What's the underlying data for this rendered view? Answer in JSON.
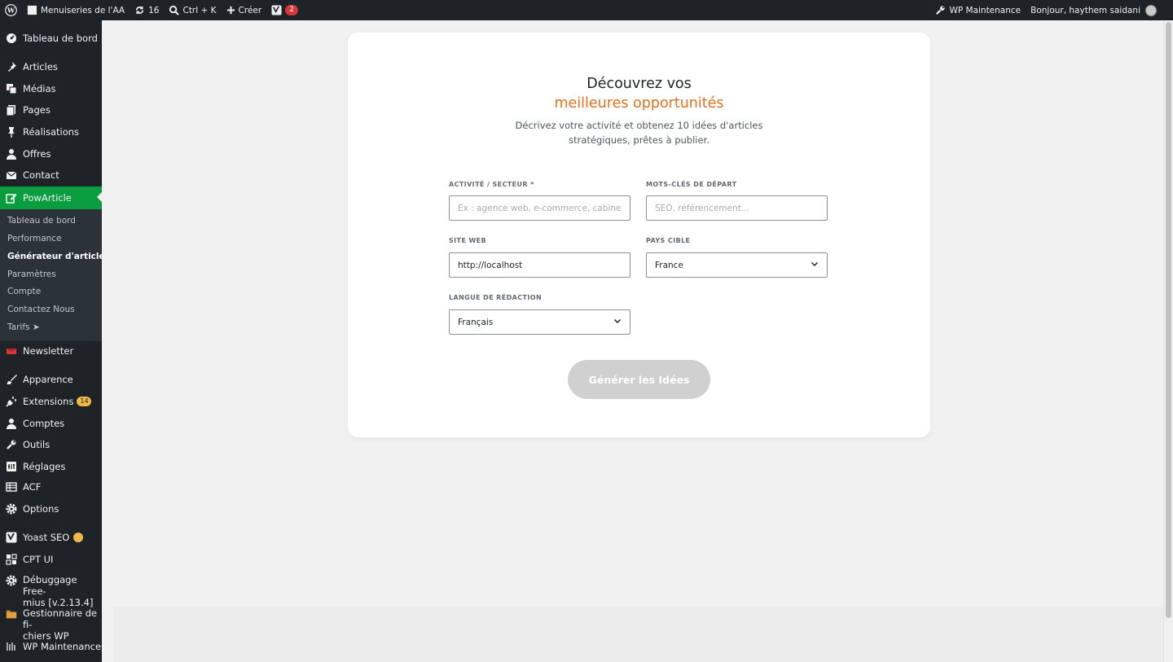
{
  "adminbar": {
    "site_name": "Menuiseries de l'AA",
    "updates_count": "16",
    "search_shortcut": "Ctrl + K",
    "new_label": "Créer",
    "yoast_count": "2",
    "wp_maintenance_label": "WP Maintenance",
    "greeting": "Bonjour, haythem saidani"
  },
  "sidebar": {
    "items": [
      {
        "label": "Tableau de bord",
        "icon": "dashboard-icon"
      },
      {
        "label": "Articles",
        "icon": "pin-icon"
      },
      {
        "label": "Médias",
        "icon": "media-icon"
      },
      {
        "label": "Pages",
        "icon": "pages-icon"
      },
      {
        "label": "Réalisations",
        "icon": "pushpin-icon"
      },
      {
        "label": "Offres",
        "icon": "person-icon"
      },
      {
        "label": "Contact",
        "icon": "envelope-icon"
      },
      {
        "label": "PowArticle",
        "icon": "edit-icon"
      },
      {
        "label": "Newsletter",
        "icon": "mail-icon"
      },
      {
        "label": "Apparence",
        "icon": "brush-icon"
      },
      {
        "label": "Extensions",
        "icon": "plug-icon",
        "badge": "14"
      },
      {
        "label": "Comptes",
        "icon": "user-icon"
      },
      {
        "label": "Outils",
        "icon": "wrench-icon"
      },
      {
        "label": "Réglages",
        "icon": "settings-icon"
      },
      {
        "label": "ACF",
        "icon": "grid-icon"
      },
      {
        "label": "Options",
        "icon": "gear-icon"
      },
      {
        "label": "Yoast SEO",
        "icon": "yoast-icon"
      },
      {
        "label": "CPT UI",
        "icon": "cpt-icon"
      },
      {
        "label": "Débuggage Free-",
        "label2": "mius [v.2.13.4]",
        "icon": "gear-icon"
      },
      {
        "label": "Gestionnaire de fi-",
        "label2": "chiers WP",
        "icon": "folder-icon"
      },
      {
        "label": "WP Maintenance",
        "icon": "maintenance-icon"
      }
    ],
    "submenu": [
      "Tableau de bord",
      "Performance",
      "Générateur d'articles",
      "Paramètres",
      "Compte",
      "Contactez Nous",
      "Tarifs ➤"
    ]
  },
  "card": {
    "title_line1": "Découvrez vos",
    "title_line2": "meilleures opportunités",
    "description": "Décrivez votre activité et obtenez 10 idées d'articles stratégiques, prêtes à publier.",
    "fields": {
      "activity_label": "ACTIVITÉ / SECTEUR *",
      "activity_placeholder": "Ex : agence web, e-commerce, cabinet RH",
      "keywords_label": "MOTS-CLÉS DE DÉPART",
      "keywords_placeholder": "SEO, référencement...",
      "website_label": "SITE WEB",
      "website_value": "http://localhost",
      "country_label": "PAYS CIBLE",
      "country_value": "France",
      "language_label": "LANGUE DE RÉDACTION",
      "language_value": "Français"
    },
    "generate_button": "Générer les Idées"
  },
  "colors": {
    "accent_orange": "#e2711d",
    "menu_active_green": "#0a9d3f",
    "adminbar_bg": "#1d2327"
  }
}
